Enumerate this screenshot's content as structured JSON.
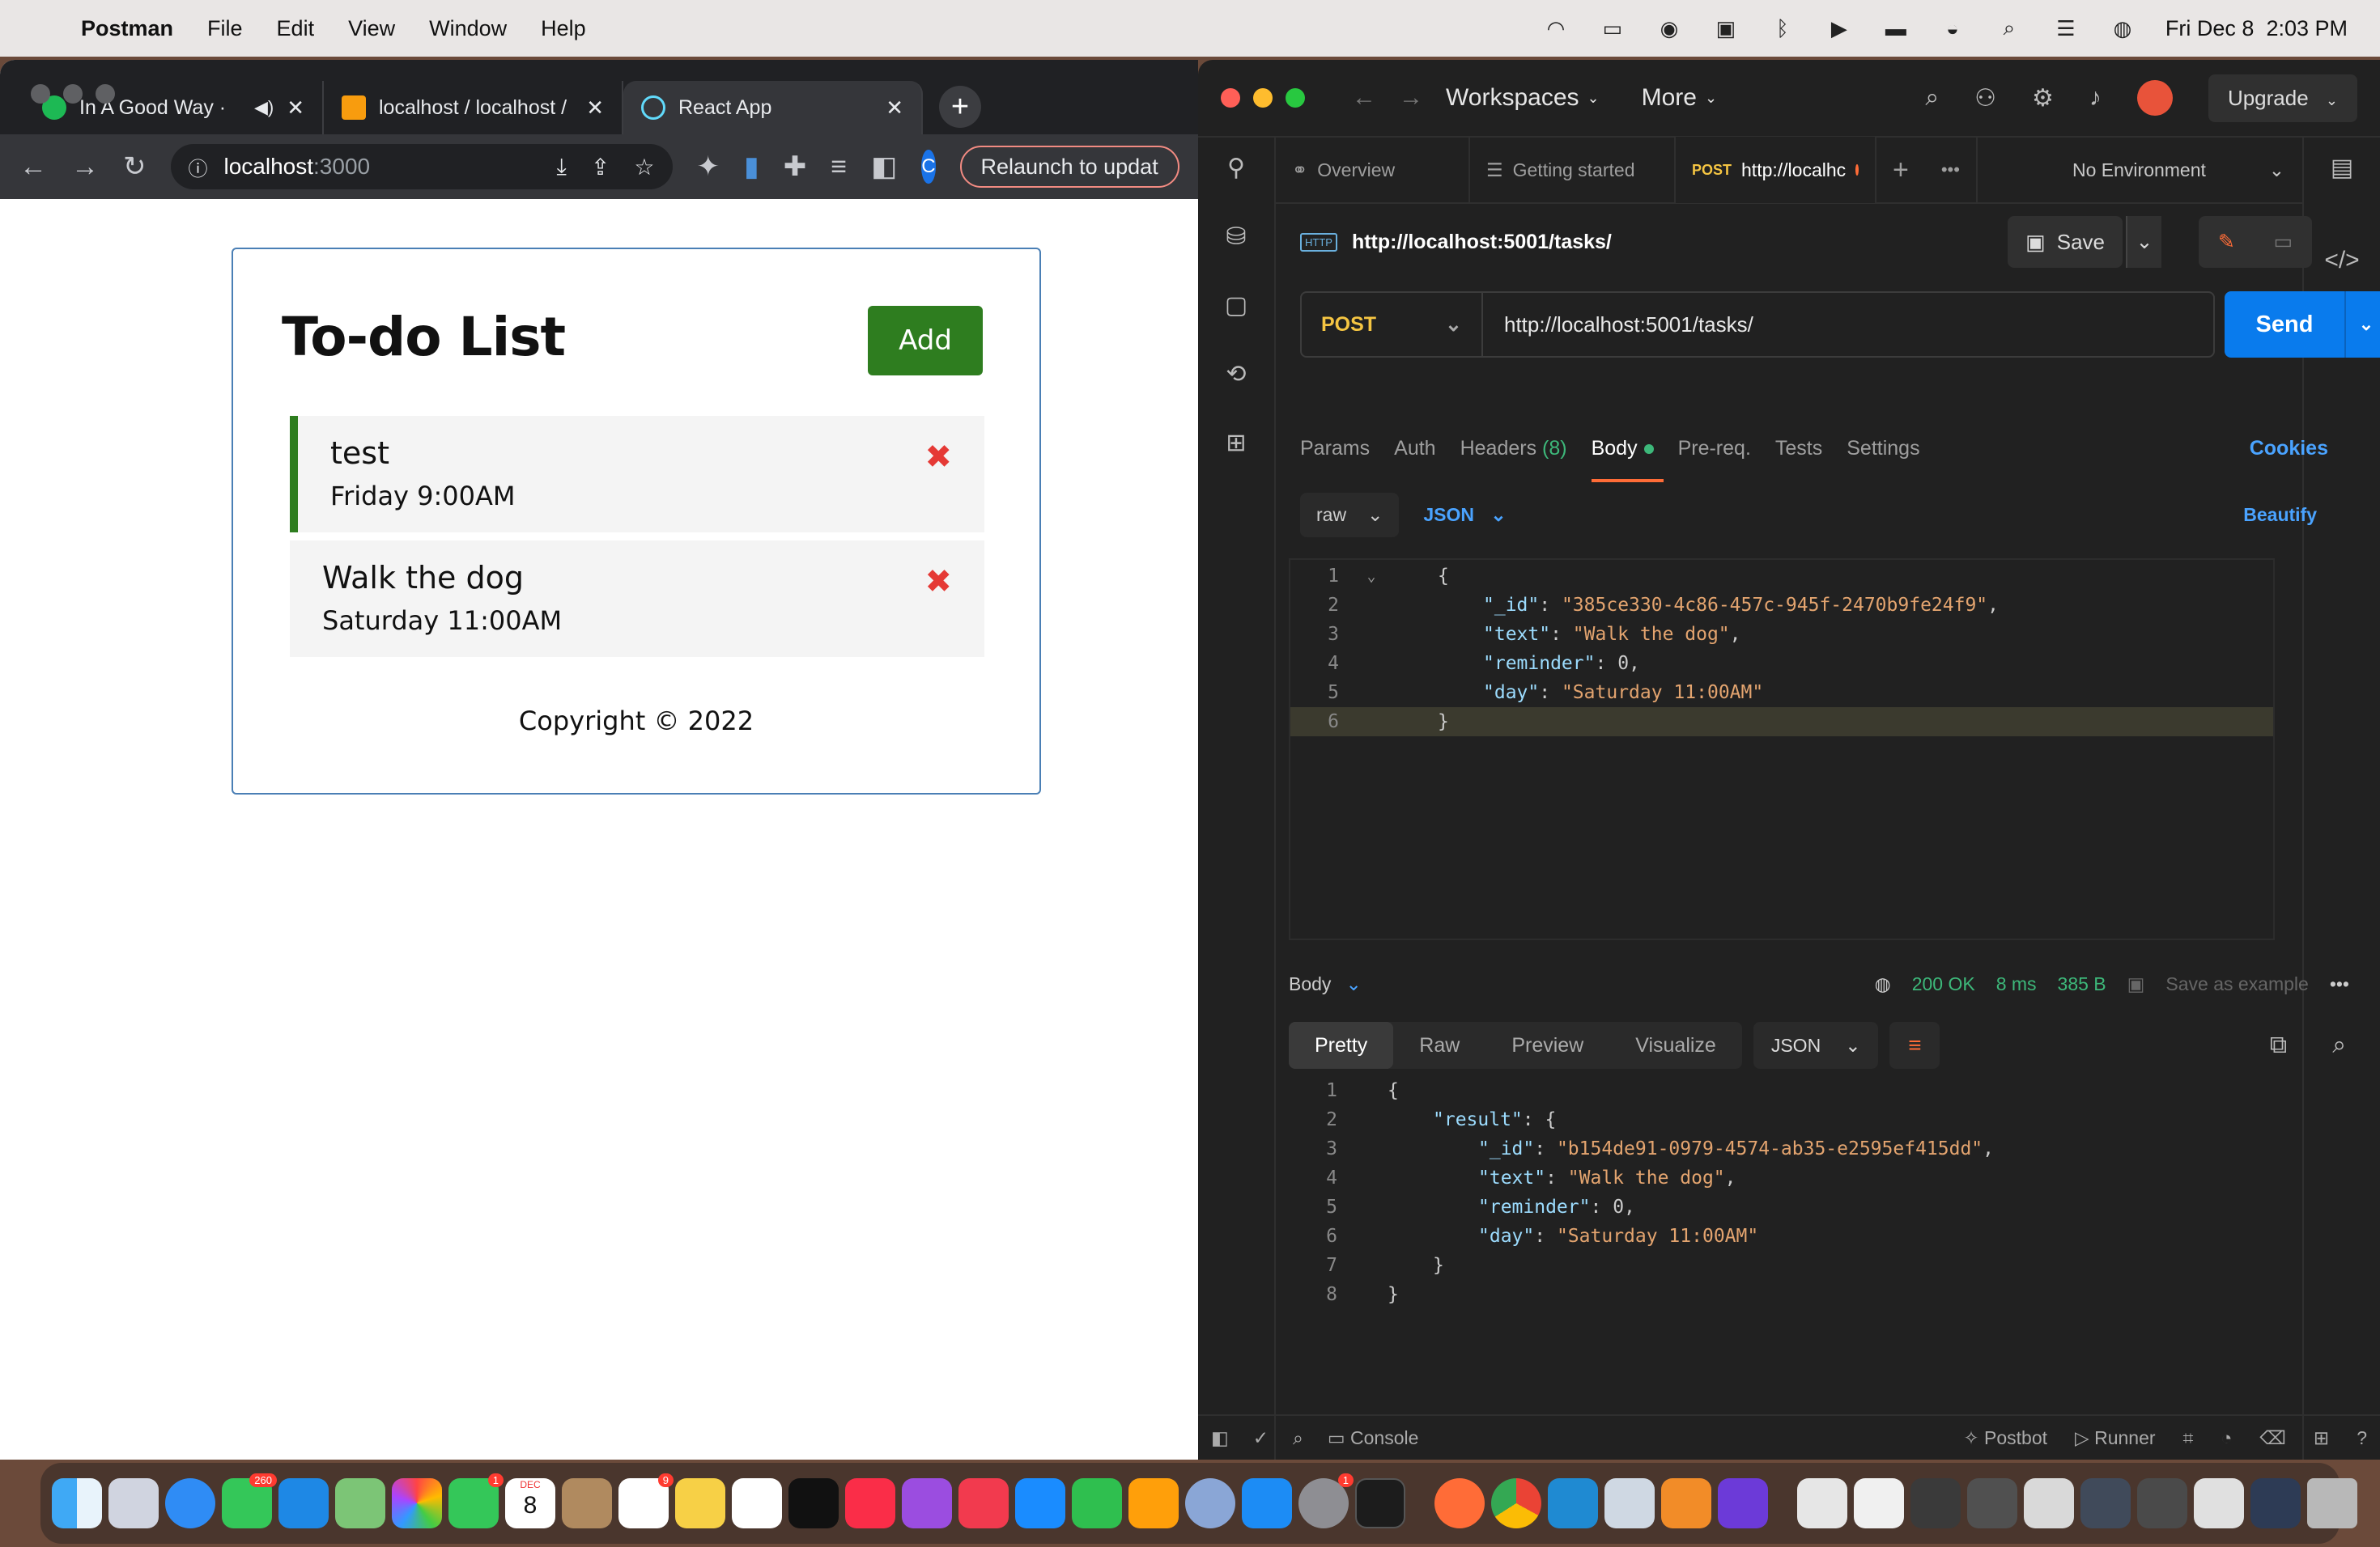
{
  "menubar": {
    "app_name": "Postman",
    "items": [
      "File",
      "Edit",
      "View",
      "Window",
      "Help"
    ],
    "clock": "Fri Dec 8  2:03 PM"
  },
  "browser": {
    "tabs": [
      {
        "title": "In A Good Way ·",
        "favicon": "spotify-icon",
        "color": "#1db954"
      },
      {
        "title": "localhost / localhost /",
        "favicon": "phpmyadmin-icon",
        "color": "#f89c0e"
      },
      {
        "title": "React App",
        "favicon": "react-icon",
        "color": "#61dafb"
      }
    ],
    "url_host": "localhost",
    "url_port": ":3000",
    "profile_initial": "C",
    "relaunch_label": "Relaunch to updat"
  },
  "todo": {
    "title": "To-do List",
    "add_label": "Add",
    "tasks": [
      {
        "text": "test",
        "day": "Friday 9:00AM",
        "reminder": true
      },
      {
        "text": "Walk the dog",
        "day": "Saturday 11:00AM",
        "reminder": false
      }
    ],
    "delete_glyph": "✖",
    "copyright": "Copyright © 2022"
  },
  "postman": {
    "workspaces_label": "Workspaces",
    "more_label": "More",
    "upgrade_label": "Upgrade",
    "tabs": {
      "overview": "Overview",
      "getting_started": "Getting started",
      "active_method": "POST",
      "active_url": "http://localhc"
    },
    "environment": "No Environment",
    "http_badge": "HTTP",
    "request_title": "http://localhost:5001/tasks/",
    "save_label": "Save",
    "method": "POST",
    "url": "http://localhost:5001/tasks/",
    "send_label": "Send",
    "request_tabs": {
      "params": "Params",
      "auth": "Auth",
      "headers": "Headers",
      "headers_count": "(8)",
      "body": "Body",
      "prereq": "Pre-req.",
      "tests": "Tests",
      "settings": "Settings",
      "cookies": "Cookies"
    },
    "body_mode": "raw",
    "body_format": "JSON",
    "beautify_label": "Beautify",
    "request_body": {
      "line_numbers": [
        "1",
        "2",
        "3",
        "4",
        "5",
        "6"
      ],
      "open": "{",
      "id_key": "\"_id\"",
      "id_val": "\"385ce330-4c86-457c-945f-2470b9fe24f9\"",
      "text_key": "\"text\"",
      "text_val": "\"Walk the dog\"",
      "reminder_key": "\"reminder\"",
      "reminder_val": "0",
      "day_key": "\"day\"",
      "day_val": "\"Saturday 11:00AM\"",
      "close": "}"
    },
    "response": {
      "label": "Body",
      "status": "200 OK",
      "time": "8 ms",
      "size": "385 B",
      "save_example": "Save as example",
      "view_tabs": [
        "Pretty",
        "Raw",
        "Preview",
        "Visualize"
      ],
      "format": "JSON",
      "line_numbers": [
        "1",
        "2",
        "3",
        "4",
        "5",
        "6",
        "7",
        "8"
      ],
      "open": "{",
      "result_key": "\"result\"",
      "id_key": "\"_id\"",
      "id_val": "\"b154de91-0979-4574-ab35-e2595ef415dd\"",
      "text_key": "\"text\"",
      "text_val": "\"Walk the dog\"",
      "reminder_key": "\"reminder\"",
      "reminder_val": "0",
      "day_key": "\"day\"",
      "day_val": "\"Saturday 11:00AM\"",
      "inner_close": "}",
      "close": "}"
    },
    "status_bar": {
      "console": "Console",
      "postbot": "Postbot",
      "runner": "Runner"
    }
  },
  "dock": {
    "badges": {
      "messages": "260",
      "facetime": "1",
      "reminders": "9",
      "settings": "1"
    },
    "calendar_month": "DEC",
    "calendar_day": "8"
  }
}
